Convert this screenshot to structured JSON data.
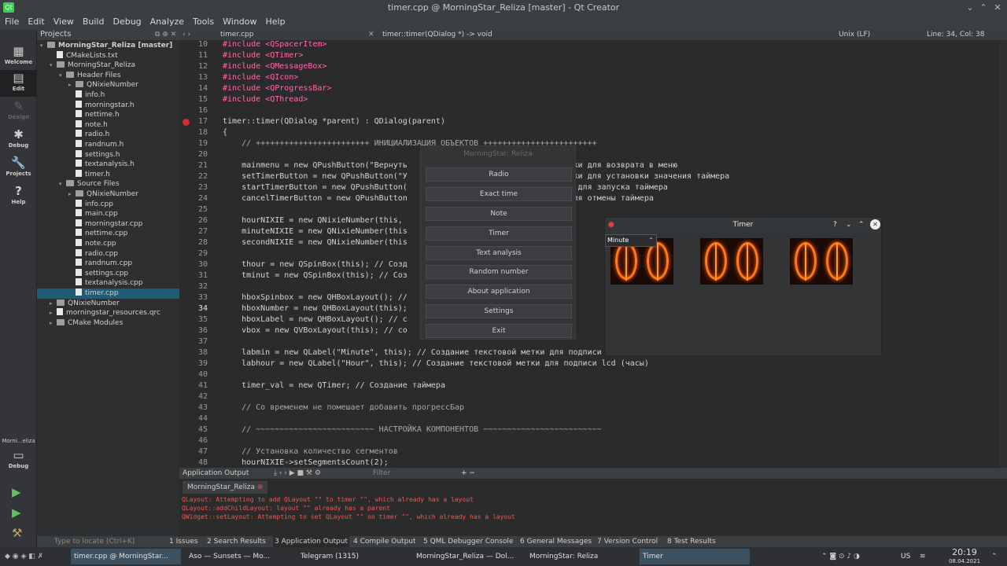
{
  "window": {
    "title": "timer.cpp @ MorningStar_Reliza [master] - Qt Creator"
  },
  "menu": [
    "File",
    "Edit",
    "View",
    "Build",
    "Debug",
    "Analyze",
    "Tools",
    "Window",
    "Help"
  ],
  "modes": [
    {
      "label": "Welcome",
      "icon": "grid-icon"
    },
    {
      "label": "Edit",
      "icon": "edit-icon"
    },
    {
      "label": "Design",
      "icon": "pen-icon"
    },
    {
      "label": "Debug",
      "icon": "bug-icon"
    },
    {
      "label": "Projects",
      "icon": "wrench-icon"
    },
    {
      "label": "Help",
      "icon": "help-icon"
    }
  ],
  "kit": {
    "name": "Morni...eliza",
    "mode": "Debug"
  },
  "projects": {
    "header": "Projects",
    "tree": [
      "MorningStar_Reliza [master]",
      "CMakeLists.txt",
      "MorningStar_Reliza",
      "Header Files",
      "QNixieNumber",
      "info.h",
      "morningstar.h",
      "nettime.h",
      "note.h",
      "radio.h",
      "randnum.h",
      "settings.h",
      "textanalysis.h",
      "timer.h",
      "Source Files",
      "QNixieNumber",
      "info.cpp",
      "main.cpp",
      "morningstar.cpp",
      "nettime.cpp",
      "note.cpp",
      "radio.cpp",
      "randnum.cpp",
      "settings.cpp",
      "textanalysis.cpp",
      "timer.cpp",
      "QNixieNumber",
      "morningstar_resources.qrc",
      "CMake Modules"
    ]
  },
  "editorbar": {
    "file": "timer.cpp",
    "symbol": "timer::timer(QDialog *) -> void",
    "encoding": "Unix (LF)",
    "position": "Line: 34, Col: 38"
  },
  "code": {
    "lines": [
      "10",
      "11",
      "12",
      "13",
      "14",
      "15",
      "16",
      "17",
      "18",
      "19",
      "20",
      "21",
      "22",
      "23",
      "24",
      "25",
      "26",
      "27",
      "28",
      "29",
      "30",
      "31",
      "32",
      "33",
      "34",
      "35",
      "36",
      "37",
      "38",
      "39",
      "40",
      "41",
      "42",
      "43",
      "44",
      "45",
      "46",
      "47",
      "48"
    ],
    "text": [
      "#include <QSpacerItem>",
      "#include <QTimer>",
      "#include <QMessageBox>",
      "#include <QIcon>",
      "#include <QProgressBar>",
      "#include <QThread>",
      "",
      "timer::timer(QDialog *parent) : QDialog(parent)",
      "{",
      "    // ++++++++++++++++++++++++ ИНИЦИАЛИЗАЦИЯ ОБЪЕКТОВ ++++++++++++++++++++++++",
      "",
      "    mainmenu = new QPushButton(\"Вернуть                               кнопки для возврата в меню",
      "    setTimerButton = new QPushButton(\"У                               кнопки для установки значения таймера",
      "    startTimerButton = new QPushButton(                               опки для запуска таймера",
      "    cancelTimerButton = new QPushButton                               ки для отмены таймера",
      "",
      "    hourNIXIE = new QNixieNumber(this,",
      "    minuteNIXIE = new QNixieNumber(this",
      "    secondNIXIE = new QNixieNumber(this",
      "",
      "    thour = new QSpinBox(this); // Созд                          сов в",
      "    tminut = new QSpinBox(this); // Coз                          инут в",
      "",
      "    hboxSpinbox = new QHBoxLayout(); //                          овщик",
      "    hboxNumber = new QHBoxLayout(this);                          мпонов",
      "    hboxLabel = new QHBoxLayout(); // с                          щика",
      "    vbox = new QVBoxLayout(this); // со                          ка (дл",
      "",
      "    labmin = new QLabel(\"Minute\", this); // Создание текстовой метки для подписи lcd (минуты)",
      "    labhour = new QLabel(\"Hour\", this); // Создание текстовой метки для подписи lcd (часы)",
      "",
      "    timer_val = new QTimer; // Создание таймера",
      "",
      "    // Со временем не помешает добавить прогрессБар",
      "",
      "    // ~~~~~~~~~~~~~~~~~~~~~~~~~ НАСТРОЙКА КОМПОНЕНТОВ ~~~~~~~~~~~~~~~~~~~~~~~~~",
      "",
      "    // Установка количество сегментов",
      "    hourNIXIE->setSegmentsCount(2);"
    ]
  },
  "output": {
    "header": "Application Output",
    "filter": "Filter",
    "tab": "MorningStar_Reliza",
    "lines": [
      "QLayout: Attempting to add QLayout \"\" to timer \"\", which already has a layout",
      "QLayout::addChildLayout: layout \"\" already has a parent",
      "QWidget::setLayout: Attempting to set QLayout \"\" on timer \"\", which already has a layout"
    ]
  },
  "statusbar": {
    "locate": "Type to locate (Ctrl+K)",
    "tabs": [
      "1 Issues",
      "2 Search Results",
      "3 Application Output",
      "4 Compile Output",
      "5 QML Debugger Console",
      "6 General Messages",
      "7 Version Control",
      "8 Test Results"
    ]
  },
  "morningstar_menu": {
    "title": "MorningStar: Reliza",
    "buttons": [
      "Radio",
      "Exact time",
      "Note",
      "Timer",
      "Text analysis",
      "Random number",
      "About application",
      "Settings",
      "Exit"
    ]
  },
  "timer_window": {
    "title": "Timer",
    "combo": "Minute",
    "digits": [
      "0",
      "0",
      "0",
      "0",
      "0",
      "0"
    ]
  },
  "taskbar": {
    "items": [
      "timer.cpp @ MorningStar...",
      "Aso — Sunsets — Mo...",
      "Telegram (1315)",
      "MorningStar_Reliza — Dol...",
      "MorningStar: Reliza",
      "Timer"
    ],
    "lang": "US",
    "time": "20:19",
    "date": "08.04.2021"
  }
}
